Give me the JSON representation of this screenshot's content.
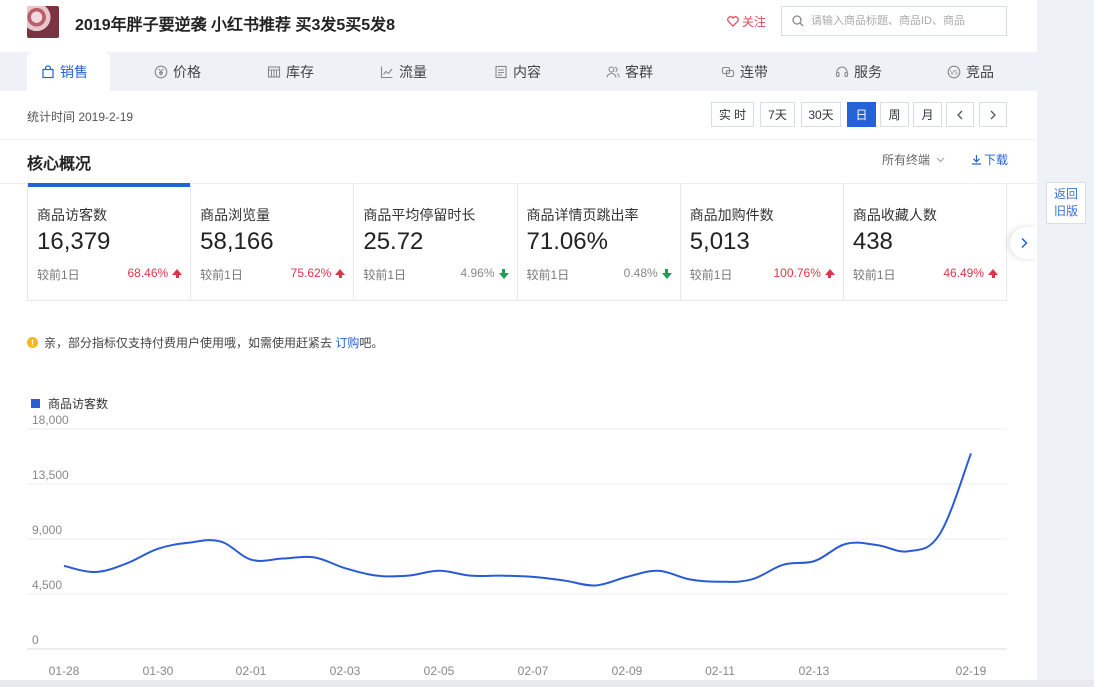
{
  "product": {
    "title": "2019年胖子要逆袭 小红书推荐 买3发5买5发8"
  },
  "header": {
    "follow_label": "关注",
    "search_placeholder": "请输入商品标题、商品ID、商品"
  },
  "tabs": [
    {
      "label": "销售",
      "icon": "bag-icon",
      "active": true
    },
    {
      "label": "价格",
      "icon": "yen-icon"
    },
    {
      "label": "库存",
      "icon": "warehouse-icon"
    },
    {
      "label": "流量",
      "icon": "trend-icon"
    },
    {
      "label": "内容",
      "icon": "document-icon"
    },
    {
      "label": "客群",
      "icon": "users-icon"
    },
    {
      "label": "连带",
      "icon": "link-icon"
    },
    {
      "label": "服务",
      "icon": "headset-icon"
    },
    {
      "label": "竞品",
      "icon": "vs-icon"
    }
  ],
  "stats": {
    "time_label": "统计时间 2019-2-19",
    "periods": [
      "实 时",
      "7天",
      "30天",
      "日",
      "周",
      "月"
    ],
    "active_period": "日"
  },
  "core": {
    "title": "核心概况",
    "terminal": "所有终端",
    "download": "下载",
    "compare_label": "较前1日",
    "metrics": [
      {
        "name": "商品访客数",
        "value": "16,379",
        "change": "68.46%",
        "dir": "up",
        "active": true
      },
      {
        "name": "商品浏览量",
        "value": "58,166",
        "change": "75.62%",
        "dir": "up"
      },
      {
        "name": "商品平均停留时长",
        "value": "25.72",
        "change": "4.96%",
        "dir": "down"
      },
      {
        "name": "商品详情页跳出率",
        "value": "71.06%",
        "change": "0.48%",
        "dir": "down"
      },
      {
        "name": "商品加购件数",
        "value": "5,013",
        "change": "100.76%",
        "dir": "up"
      },
      {
        "name": "商品收藏人数",
        "value": "438",
        "change": "46.49%",
        "dir": "up"
      }
    ]
  },
  "side": {
    "old_version_line1": "返回",
    "old_version_line2": "旧版"
  },
  "notice": {
    "text_before": "亲，部分指标仅支持付费用户使用哦，如需使用赶紧去 ",
    "link": "订购",
    "text_after": "吧。"
  },
  "colors": {
    "accent": "#2463d6",
    "up": "#e0344a",
    "down": "#1f9d55",
    "line": "#2a5bd7"
  },
  "chart_data": {
    "type": "line",
    "series": [
      {
        "name": "商品访客数",
        "values": [
          6800,
          6300,
          7000,
          8200,
          8700,
          8800,
          7300,
          7400,
          7500,
          6600,
          6000,
          6000,
          6400,
          6000,
          6000,
          5900,
          5600,
          5200,
          5900,
          6400,
          5700,
          5500,
          5700,
          6900,
          7200,
          8600,
          8500,
          8000,
          9400,
          16000
        ]
      }
    ],
    "x_tick_labels": [
      "01-28",
      "01-30",
      "02-01",
      "02-03",
      "02-05",
      "02-07",
      "02-09",
      "02-11",
      "02-13",
      "02-19"
    ],
    "y_tick_labels": [
      "0",
      "4,500",
      "9,000",
      "13,500",
      "18,000"
    ],
    "ylim": [
      0,
      18000
    ],
    "grid": true
  }
}
